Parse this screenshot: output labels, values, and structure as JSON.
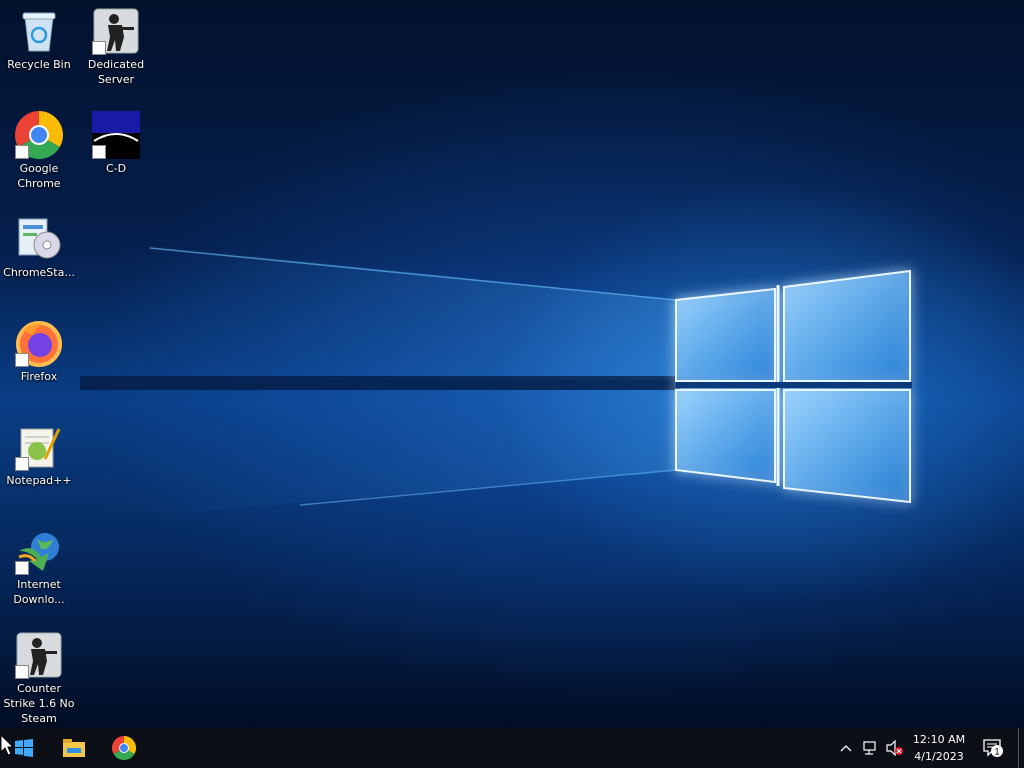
{
  "desktop": {
    "icons": [
      {
        "id": "recycle-bin",
        "label": "Recycle Bin"
      },
      {
        "id": "dedicated-server",
        "label": "Dedicated Server"
      },
      {
        "id": "google-chrome",
        "label": "Google Chrome"
      },
      {
        "id": "c-d",
        "label": "C-D"
      },
      {
        "id": "chromesta",
        "label": "ChromeSta..."
      },
      {
        "id": "firefox",
        "label": "Firefox"
      },
      {
        "id": "notepadpp",
        "label": "Notepad++"
      },
      {
        "id": "internet-download",
        "label": "Internet Downlo..."
      },
      {
        "id": "counter-strike",
        "label": "Counter Strike 1.6 No Steam"
      }
    ]
  },
  "taskbar": {
    "clock": {
      "time": "12:10 AM",
      "date": "4/1/2023"
    },
    "notification_count": "1",
    "pinned": [
      "start-icon",
      "file-explorer-icon",
      "chrome-icon"
    ],
    "tray_icons": [
      "chevron-up-icon",
      "network-icon",
      "volume-muted-icon"
    ]
  },
  "colors": {
    "taskbar_bg": "#0d0f16",
    "accent": "#1e90ff",
    "wallpaper_dark": "#03112c"
  }
}
